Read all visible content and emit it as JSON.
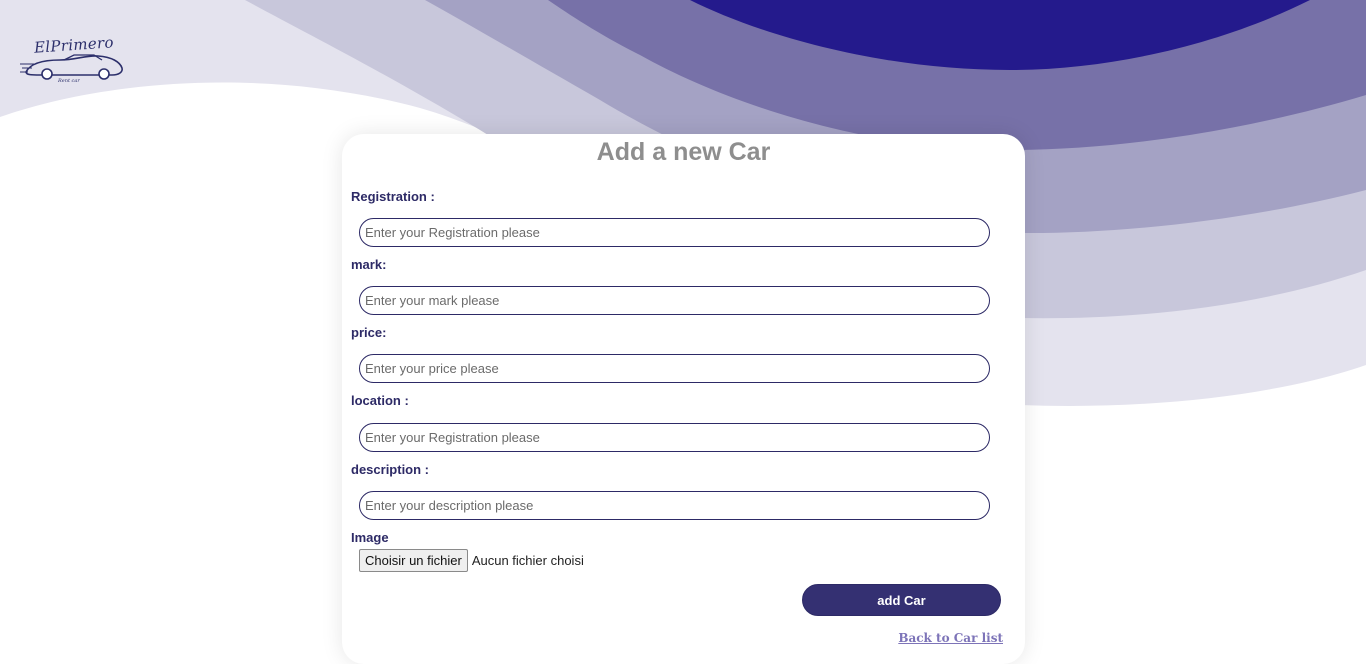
{
  "brand": {
    "logo_text": "ElPrimero",
    "logo_subtext": "Rent car",
    "colors": {
      "primary": "#2d2a66",
      "wave_dark": "#241a8c",
      "wave_mid": "#7771a8",
      "wave_light": "#a4a2c4",
      "wave_pale": "#c8c7db",
      "wave_palest": "#e4e3ee"
    }
  },
  "form": {
    "title": "Add a new Car",
    "fields": [
      {
        "label": "Registration :",
        "placeholder": "Enter your Registration please"
      },
      {
        "label": "mark:",
        "placeholder": "Enter your mark please"
      },
      {
        "label": "price:",
        "placeholder": "Enter your price please"
      },
      {
        "label": "location :",
        "placeholder": "Enter your Registration please"
      },
      {
        "label": "description :",
        "placeholder": "Enter your description please"
      }
    ],
    "image": {
      "label": "Image",
      "button_label": "Choisir un fichier",
      "status": "Aucun fichier choisi"
    },
    "submit_label": "add Car",
    "back_link": "Back to Car list"
  }
}
